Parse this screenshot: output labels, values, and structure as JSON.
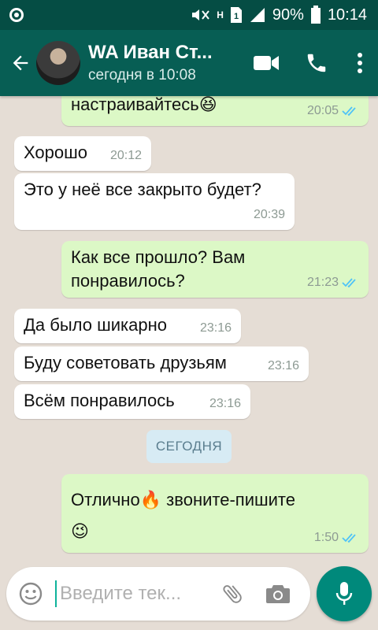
{
  "status_bar": {
    "battery_percent": "90%",
    "time": "10:14",
    "network": "H"
  },
  "header": {
    "title": "WA Иван Ст...",
    "subtitle": "сегодня в 10:08"
  },
  "messages": [
    {
      "direction": "out",
      "text": "настраивайтесь😆",
      "time": "20:05",
      "read": true
    },
    {
      "direction": "in",
      "text": "Хорошо",
      "time": "20:12"
    },
    {
      "direction": "in",
      "text": "Это у неё все закрыто будет?",
      "time": "20:39"
    },
    {
      "direction": "out",
      "text_lines": [
        "Как все прошло? Вам",
        "понравилось?"
      ],
      "time": "21:23",
      "read": true
    },
    {
      "direction": "in",
      "text": "Да было шикарно",
      "time": "23:16"
    },
    {
      "direction": "in",
      "text": "Буду советовать друзьям",
      "time": "23:16"
    },
    {
      "direction": "in",
      "text": "Всём понравилось",
      "time": "23:16"
    },
    {
      "direction": "out",
      "text_lines": [
        "Отлично🔥 звоните-пишите",
        "😉"
      ],
      "time": "1:50",
      "read": true
    }
  ],
  "date_divider": "СЕГОДНЯ",
  "input": {
    "placeholder": "Введите тек..."
  },
  "colors": {
    "header": "#075e54",
    "status_bar": "#054d44",
    "outgoing_bubble": "#dcf8c6",
    "incoming_bubble": "#ffffff",
    "read_ticks": "#4fc3f7",
    "mic_button": "#00897b",
    "chat_background": "#e5ddd5"
  },
  "icons": [
    "whatsapp-notification-icon",
    "mute-icon",
    "sim-icon",
    "signal-icon",
    "battery-icon",
    "back-arrow-icon",
    "video-call-icon",
    "phone-icon",
    "more-vert-icon",
    "emoji-icon",
    "attach-icon",
    "camera-icon",
    "mic-icon",
    "double-check-icon"
  ]
}
